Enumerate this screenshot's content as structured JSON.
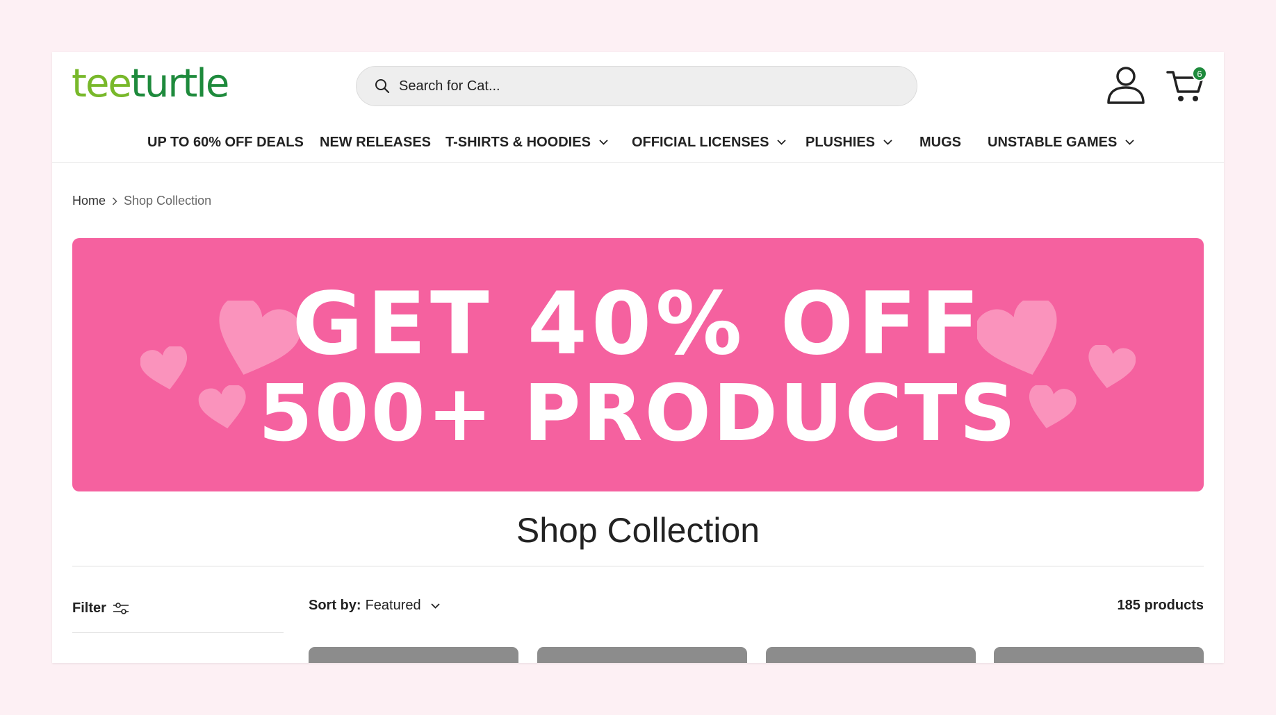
{
  "brand": {
    "logo_part1": "tee",
    "logo_part2": "turtle"
  },
  "search": {
    "placeholder": "Search for Cat..."
  },
  "cart": {
    "count": "6"
  },
  "nav": {
    "items": [
      {
        "label": "UP TO 60% OFF DEALS",
        "has_dropdown": false
      },
      {
        "label": "NEW RELEASES",
        "has_dropdown": false
      },
      {
        "label": "T-SHIRTS & HOODIES",
        "has_dropdown": true
      },
      {
        "label": "OFFICIAL LICENSES",
        "has_dropdown": true
      },
      {
        "label": "PLUSHIES",
        "has_dropdown": true
      },
      {
        "label": "MUGS",
        "has_dropdown": false
      },
      {
        "label": "UNSTABLE GAMES",
        "has_dropdown": true
      }
    ]
  },
  "breadcrumb": {
    "home": "Home",
    "current": "Shop Collection"
  },
  "banner": {
    "line1": "GET 40% OFF",
    "line2": "500+ PRODUCTS",
    "background_color": "#f5619f",
    "heart_color": "#fa93bc"
  },
  "page": {
    "title": "Shop Collection"
  },
  "toolbar": {
    "filter_label": "Filter",
    "sort_label": "Sort by:",
    "sort_value": "Featured",
    "product_count": "185 products"
  },
  "colors": {
    "brand_light_green": "#78b82a",
    "brand_dark_green": "#1e8a3c",
    "page_background": "#fdf0f4"
  }
}
